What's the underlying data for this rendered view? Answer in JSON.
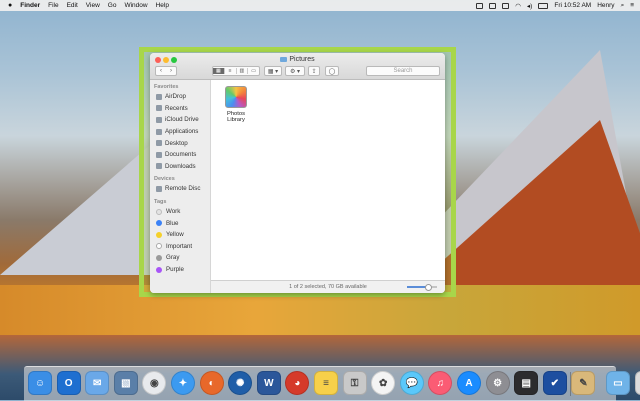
{
  "menubar": {
    "apple_icon": "apple-icon",
    "app_name": "Finder",
    "items": [
      "File",
      "Edit",
      "View",
      "Go",
      "Window",
      "Help"
    ],
    "clock": "Fri 10:52 AM",
    "user": "Henry"
  },
  "window": {
    "title": "Pictures",
    "toolbar": {
      "back": "‹",
      "forward": "›",
      "view_modes": [
        "▦",
        "≡",
        "▥",
        "▭"
      ],
      "arrange": "▦ ▾",
      "action": "⚙ ▾",
      "share": "⇪",
      "tag": "◯",
      "search_placeholder": "Search"
    },
    "sidebar": {
      "favorites_header": "Favorites",
      "favorites": [
        "AirDrop",
        "Recents",
        "iCloud Drive",
        "Applications",
        "Desktop",
        "Documents",
        "Downloads"
      ],
      "devices_header": "Devices",
      "devices": [
        "Remote Disc"
      ],
      "tags_header": "Tags",
      "tags": [
        {
          "label": "Work",
          "color": "#e3e3e3"
        },
        {
          "label": "Blue",
          "color": "#3b82f6"
        },
        {
          "label": "Yellow",
          "color": "#f5d02a"
        },
        {
          "label": "Important",
          "color": "#ffffff"
        },
        {
          "label": "Gray",
          "color": "#9a9a9a"
        },
        {
          "label": "Purple",
          "color": "#a855f7"
        }
      ]
    },
    "content": {
      "items": [
        {
          "label": "Photos Library",
          "icon": "photos-library-icon"
        }
      ]
    },
    "status": "1 of 2 selected, 70 GB available",
    "icon_size_level": 0.7
  },
  "dock": {
    "icons": [
      {
        "name": "finder",
        "color": "#3a8ee6",
        "glyph": "☺"
      },
      {
        "name": "outlook",
        "color": "#1e6fd0",
        "glyph": "O"
      },
      {
        "name": "mail",
        "color": "#6aa8e8",
        "glyph": "✉"
      },
      {
        "name": "preview",
        "color": "#5a7fa8",
        "glyph": "▧"
      },
      {
        "name": "chrome",
        "color": "#e8eaed",
        "glyph": "◉"
      },
      {
        "name": "safari",
        "color": "#3c9af0",
        "glyph": "✦"
      },
      {
        "name": "firefox",
        "color": "#e8682a",
        "glyph": "◐"
      },
      {
        "name": "network",
        "color": "#1f5ea8",
        "glyph": "✺"
      },
      {
        "name": "word",
        "color": "#2b579a",
        "glyph": "W"
      },
      {
        "name": "photo-booth",
        "color": "#d53a2a",
        "glyph": "◕"
      },
      {
        "name": "notes",
        "color": "#f7d04a",
        "glyph": "≡"
      },
      {
        "name": "keychain",
        "color": "#c9c9c9",
        "glyph": "⚿"
      },
      {
        "name": "photos",
        "color": "#f4f4f4",
        "glyph": "✿"
      },
      {
        "name": "messages",
        "color": "#5ac8fa",
        "glyph": "💬"
      },
      {
        "name": "music",
        "color": "#fb5c74",
        "glyph": "♫"
      },
      {
        "name": "app-store",
        "color": "#1a8cff",
        "glyph": "A"
      },
      {
        "name": "system-preferences",
        "color": "#8e8e93",
        "glyph": "⚙"
      },
      {
        "name": "activity-monitor",
        "color": "#2c2c2e",
        "glyph": "▤"
      },
      {
        "name": "tasks",
        "color": "#1d4fa0",
        "glyph": "✔"
      },
      {
        "name": "script-editor",
        "color": "#d9b87a",
        "glyph": "✎"
      },
      {
        "name": "downloads-folder",
        "color": "#6fb3e8",
        "glyph": "▭"
      },
      {
        "name": "trash",
        "color": "#dcdcdc",
        "glyph": "🗑"
      }
    ]
  }
}
